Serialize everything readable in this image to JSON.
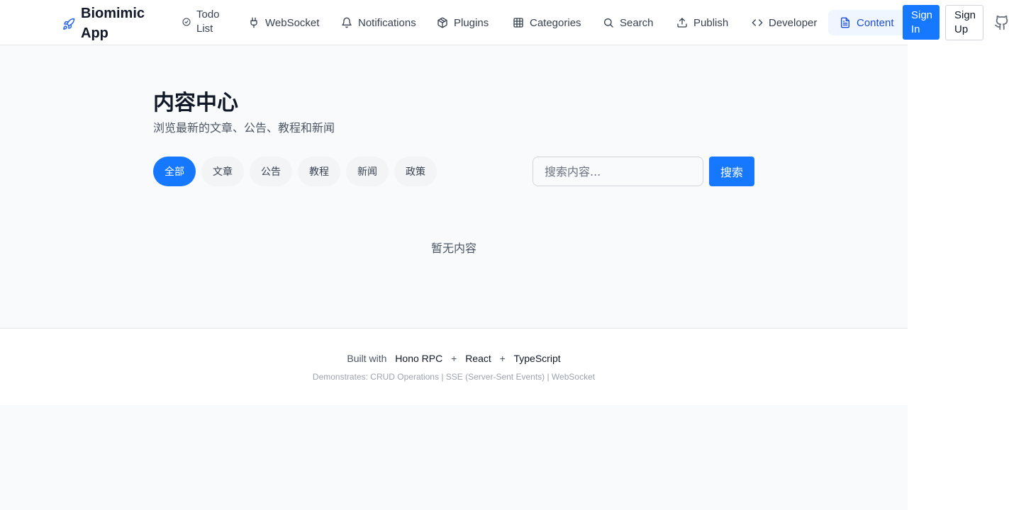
{
  "header": {
    "brand": {
      "name": "Biomimic App",
      "icon": "rocket-icon"
    },
    "nav": [
      {
        "label": "Todo List",
        "icon": "check-circle-icon"
      },
      {
        "label": "WebSocket",
        "icon": "plug-icon"
      },
      {
        "label": "Notifications",
        "icon": "bell-icon"
      },
      {
        "label": "Plugins",
        "icon": "package-icon"
      },
      {
        "label": "Categories",
        "icon": "grid-icon"
      },
      {
        "label": "Search",
        "icon": "search-icon"
      },
      {
        "label": "Publish",
        "icon": "upload-icon"
      },
      {
        "label": "Developer",
        "icon": "code-icon"
      },
      {
        "label": "Content",
        "icon": "file-text-icon",
        "active": true
      }
    ],
    "sign_in": "Sign In",
    "sign_up": "Sign Up",
    "github_icon": "github-icon"
  },
  "main": {
    "title": "内容中心",
    "subtitle": "浏览最新的文章、公告、教程和新闻",
    "filters": [
      {
        "label": "全部",
        "active": true
      },
      {
        "label": "文章"
      },
      {
        "label": "公告"
      },
      {
        "label": "教程"
      },
      {
        "label": "新闻"
      },
      {
        "label": "政策"
      }
    ],
    "search": {
      "placeholder": "搜索内容...",
      "value": "",
      "button": "搜索"
    },
    "empty_message": "暂无内容"
  },
  "footer": {
    "built_with": "Built with",
    "tech": [
      "Hono RPC",
      "React",
      "TypeScript"
    ],
    "plus": "+",
    "demonstrates": "Demonstrates: CRUD Operations | SSE (Server-Sent Events) | WebSocket"
  },
  "colors": {
    "accent": "#1677ff",
    "active_nav_bg": "#eff6ff",
    "active_nav_text": "#1d4ed8",
    "page_bg": "#f9fafb"
  }
}
